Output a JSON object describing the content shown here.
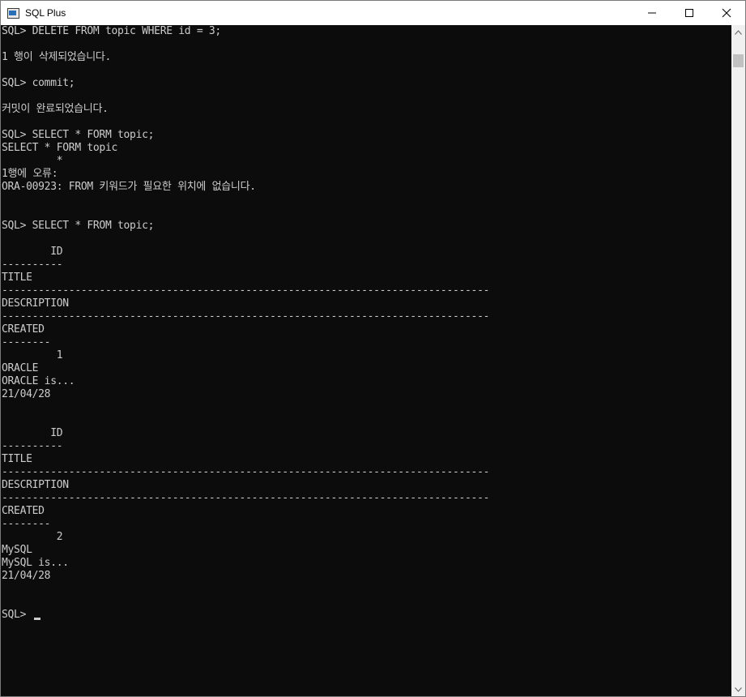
{
  "window": {
    "title": "SQL Plus"
  },
  "console": {
    "lines": [
      "SQL> DELETE FROM topic WHERE id = 3;",
      "",
      "1 행이 삭제되었습니다.",
      "",
      "SQL> commit;",
      "",
      "커밋이 완료되었습니다.",
      "",
      "SQL> SELECT * FORM topic;",
      "SELECT * FORM topic",
      "         *",
      "1행에 오류:",
      "ORA-00923: FROM 키워드가 필요한 위치에 없습니다.",
      "",
      "",
      "SQL> SELECT * FROM topic;",
      "",
      "        ID",
      "----------",
      "TITLE",
      "--------------------------------------------------------------------------------",
      "DESCRIPTION",
      "--------------------------------------------------------------------------------",
      "CREATED",
      "--------",
      "         1",
      "ORACLE",
      "ORACLE is...",
      "21/04/28",
      "",
      "",
      "        ID",
      "----------",
      "TITLE",
      "--------------------------------------------------------------------------------",
      "DESCRIPTION",
      "--------------------------------------------------------------------------------",
      "CREATED",
      "--------",
      "         2",
      "MySQL",
      "MySQL is...",
      "21/04/28",
      "",
      ""
    ],
    "prompt": "SQL> "
  },
  "icons": {
    "app": "sqlplus-console-icon",
    "minimize": "minimize-icon",
    "maximize": "maximize-icon",
    "close": "close-icon",
    "scroll_up": "scroll-up-arrow-icon",
    "scroll_down": "scroll-down-arrow-icon"
  },
  "colors": {
    "console_background": "#0c0c0c",
    "console_text": "#cccccc",
    "titlebar": "#ffffff",
    "scrollbar_track": "#f0f0f0",
    "scrollbar_thumb": "#c1c1c1"
  }
}
